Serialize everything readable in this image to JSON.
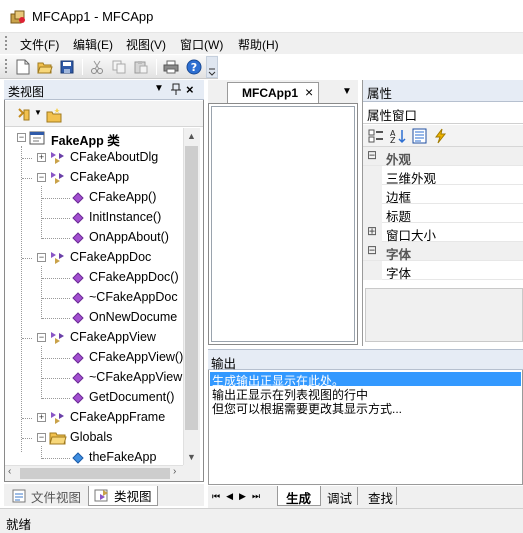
{
  "window": {
    "title": "MFCApp1 - MFCApp"
  },
  "menu": [
    "文件(F)",
    "编辑(E)",
    "视图(V)",
    "窗口(W)",
    "帮助(H)"
  ],
  "class_view": {
    "title": "类视图",
    "tree": [
      {
        "label": "FakeApp 类",
        "bold": true
      },
      {
        "label": "CFakeAboutDlg"
      },
      {
        "label": "CFakeApp"
      },
      {
        "label": "CFakeApp()"
      },
      {
        "label": "InitInstance()"
      },
      {
        "label": "OnAppAbout()"
      },
      {
        "label": "CFakeAppDoc"
      },
      {
        "label": "CFakeAppDoc()"
      },
      {
        "label": "~CFakeAppDoc"
      },
      {
        "label": "OnNewDocume"
      },
      {
        "label": "CFakeAppView"
      },
      {
        "label": "CFakeAppView()"
      },
      {
        "label": "~CFakeAppView"
      },
      {
        "label": "GetDocument()"
      },
      {
        "label": "CFakeAppFrame"
      },
      {
        "label": "Globals"
      },
      {
        "label": "theFakeApp"
      }
    ]
  },
  "left_tabs": {
    "file_view": "文件视图",
    "class_view": "类视图"
  },
  "document": {
    "tab": "MFCApp1",
    "close": "×",
    "dropdown": "▼"
  },
  "properties": {
    "title": "属性",
    "combo": "属性窗口",
    "rows": [
      {
        "label": "外观",
        "category": true,
        "sign": "⊟"
      },
      {
        "label": "三维外观"
      },
      {
        "label": "边框"
      },
      {
        "label": "标题"
      },
      {
        "label": "窗口大小",
        "sign": "⊞"
      },
      {
        "label": "字体",
        "category": true,
        "sign": "⊟"
      },
      {
        "label": "字体"
      }
    ]
  },
  "output": {
    "title": "输出",
    "lines": [
      "生成输出正显示在此处。",
      "输出正显示在列表视图的行中",
      "但您可以根据需要更改其显示方式..."
    ]
  },
  "output_tabs": [
    "生成",
    "调试",
    "查找"
  ],
  "status": {
    "text": "就绪"
  },
  "colors": {
    "selection": "#3399ff",
    "accent": "#1e4ea1"
  }
}
